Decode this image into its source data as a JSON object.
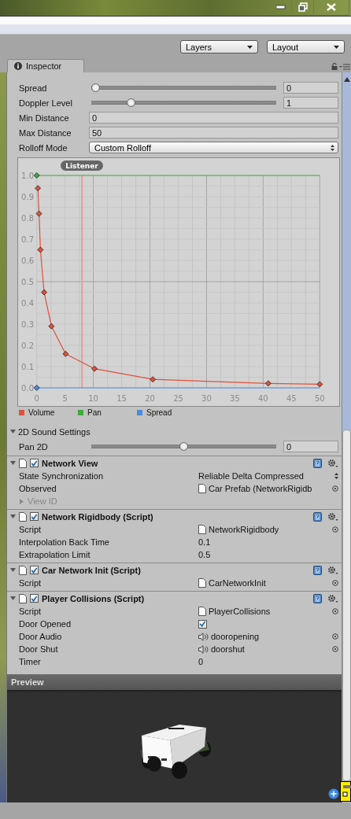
{
  "toolbar": {
    "dropdowns": [
      {
        "label": "Layers"
      },
      {
        "label": "Layout"
      }
    ]
  },
  "tab": {
    "label": "Inspector"
  },
  "inspector": {
    "rows": [
      {
        "kind": "slider",
        "label": "Spread",
        "level": 0,
        "value": "0"
      },
      {
        "kind": "slider",
        "label": "Doppler Level",
        "level": 0.2,
        "value": "1"
      },
      {
        "kind": "field",
        "label": "Min Distance",
        "value": "0"
      },
      {
        "kind": "field",
        "label": "Max Distance",
        "value": "50"
      },
      {
        "kind": "dropdown",
        "label": "Rolloff Mode",
        "value": "Custom Rolloff"
      }
    ],
    "chart_data": {
      "type": "line",
      "grid": true,
      "x": [
        0,
        0.2,
        0.4,
        0.65,
        1.3,
        2.6,
        5.1,
        10.2,
        20.5,
        40.9,
        50
      ],
      "xlim": [
        0,
        50
      ],
      "ylim": [
        0,
        1
      ],
      "xticks": [
        0,
        5,
        10,
        15,
        20,
        25,
        30,
        35,
        40,
        45,
        50
      ],
      "yticks": [
        {
          "value": 0,
          "label": "0.0"
        },
        {
          "value": 0.1,
          "label": "0.1"
        },
        {
          "value": 0.2,
          "label": "0.2"
        },
        {
          "value": 0.3,
          "label": "0.3"
        },
        {
          "value": 0.4,
          "label": "0.4"
        },
        {
          "value": 0.5,
          "label": "0.5"
        },
        {
          "value": 0.6,
          "label": "0.6"
        },
        {
          "value": 0.7,
          "label": "0.7"
        },
        {
          "value": 0.8,
          "label": "0.8"
        },
        {
          "value": 0.9,
          "label": "0.9"
        },
        {
          "value": 1,
          "label": "1.0"
        }
      ],
      "series": [
        {
          "name": "Volume",
          "color": "#e0503a",
          "marker": "diamond",
          "values": [
            null,
            0.94,
            0.82,
            0.65,
            0.45,
            0.29,
            0.16,
            0.09,
            0.04,
            0.021,
            0.017
          ]
        },
        {
          "name": "Pan",
          "color": "#3faa3f",
          "marker": "none",
          "values": [
            1,
            1,
            1,
            1,
            1,
            1,
            1,
            1,
            1,
            1,
            1
          ]
        },
        {
          "name": "Spread",
          "color": "#4a8ae0",
          "marker": "none",
          "values": [
            0,
            0,
            0,
            0,
            0,
            0,
            0,
            0,
            0,
            0,
            0
          ]
        }
      ],
      "ref_lines": [
        {
          "axis": "x",
          "value": 8,
          "label": "Listener"
        }
      ]
    },
    "subsection": {
      "title": "2D Sound Settings",
      "expanded": true,
      "rows": [
        {
          "kind": "slider",
          "label": "Pan 2D",
          "level": 0.5,
          "value": "0"
        }
      ]
    }
  },
  "components": [
    {
      "title": "Network View",
      "enabled": true,
      "expanded": true,
      "rows": [
        {
          "kind": "popup",
          "label": "State Synchronization",
          "value": "Reliable Delta Compressed"
        },
        {
          "kind": "object",
          "label": "Observed",
          "value": "Car Prefab (NetworkRigidb"
        },
        {
          "kind": "foldout",
          "label": "View ID",
          "expanded": false
        }
      ]
    },
    {
      "title": "Network Rigidbody (Script)",
      "enabled": true,
      "expanded": true,
      "rows": [
        {
          "kind": "object",
          "label": "Script",
          "value": "NetworkRigidbody"
        },
        {
          "kind": "text",
          "label": "Interpolation Back Time",
          "value": "0.1"
        },
        {
          "kind": "text",
          "label": "Extrapolation Limit",
          "value": "0.5"
        }
      ]
    },
    {
      "title": "Car Network Init (Script)",
      "enabled": true,
      "expanded": true,
      "rows": [
        {
          "kind": "object",
          "label": "Script",
          "value": "CarNetworkInit"
        }
      ]
    },
    {
      "title": "Player Collisions (Script)",
      "enabled": true,
      "expanded": true,
      "rows": [
        {
          "kind": "object",
          "label": "Script",
          "value": "PlayerCollisions"
        },
        {
          "kind": "checkbox",
          "label": "Door Opened",
          "checked": true
        },
        {
          "kind": "audio",
          "label": "Door Audio",
          "value": "dooropening"
        },
        {
          "kind": "audio",
          "label": "Door Shut",
          "value": "doorshut"
        },
        {
          "kind": "text",
          "label": "Timer",
          "value": "0"
        }
      ]
    }
  ],
  "preview": {
    "title": "Preview"
  }
}
